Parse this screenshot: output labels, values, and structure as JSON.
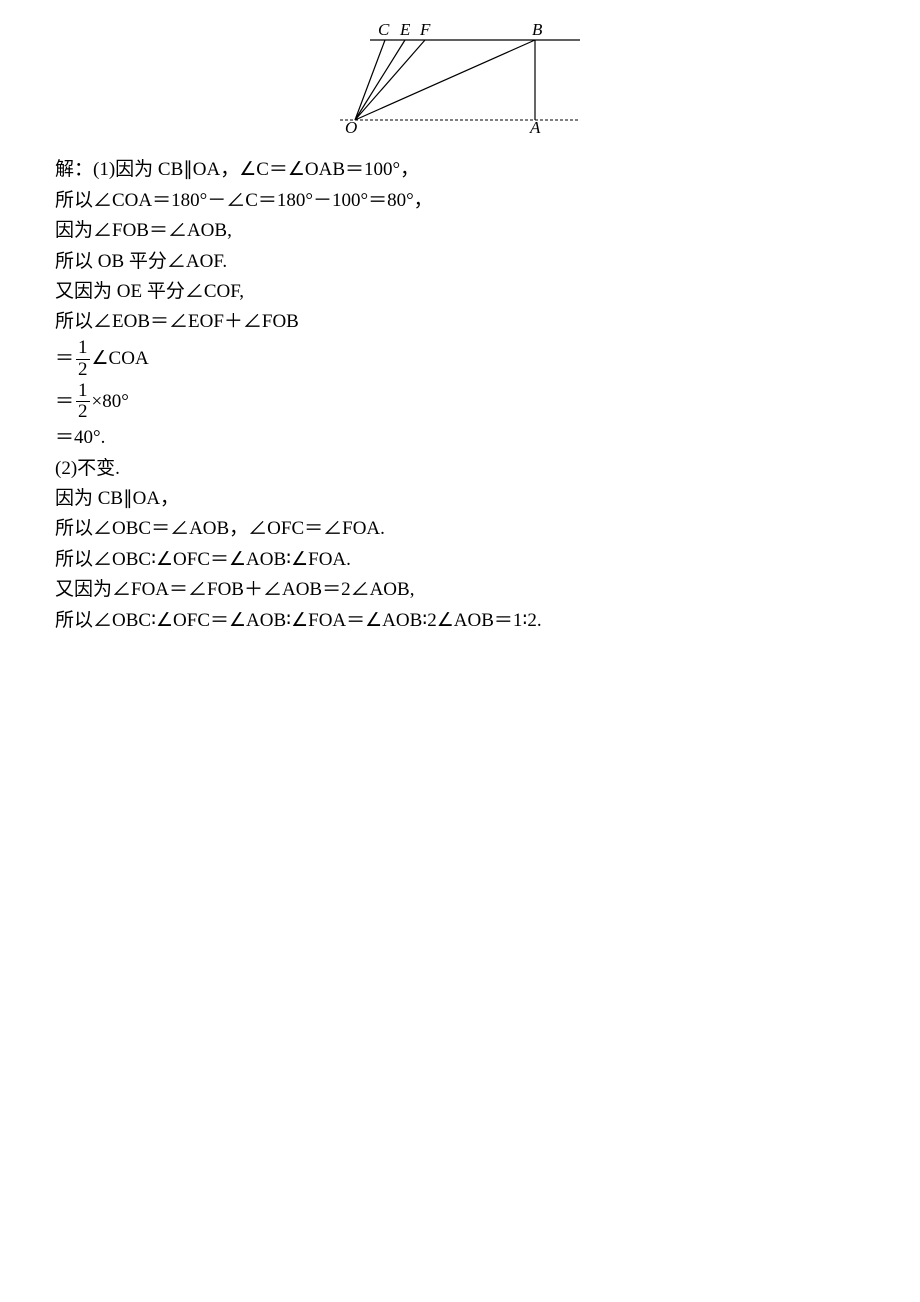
{
  "diagram": {
    "labels": {
      "C": "C",
      "E": "E",
      "F": "F",
      "B": "B",
      "O": "O",
      "A": "A"
    }
  },
  "lines": {
    "l1": "解：(1)因为 CB∥OA，∠C＝∠OAB＝100°，",
    "l2": "所以∠COA＝180°－∠C＝180°－100°＝80°，",
    "l3": "因为∠FOB＝∠AOB,",
    "l4": "所以 OB 平分∠AOF.",
    "l5": "又因为 OE 平分∠COF,",
    "l6": "所以∠EOB＝∠EOF＋∠FOB",
    "l7a": "＝",
    "l7_num": "1",
    "l7_den": "2",
    "l7b": "∠COA",
    "l8a": "＝",
    "l8_num": "1",
    "l8_den": "2",
    "l8b": "×80°",
    "l9": "＝40°.",
    "l10": "(2)不变.",
    "l11": "因为 CB∥OA，",
    "l12": "所以∠OBC＝∠AOB，∠OFC＝∠FOA.",
    "l13": "所以∠OBC∶∠OFC＝∠AOB∶∠FOA.",
    "l14": "又因为∠FOA＝∠FOB＋∠AOB＝2∠AOB,",
    "l15": "所以∠OBC∶∠OFC＝∠AOB∶∠FOA＝∠AOB∶2∠AOB＝1∶2."
  }
}
